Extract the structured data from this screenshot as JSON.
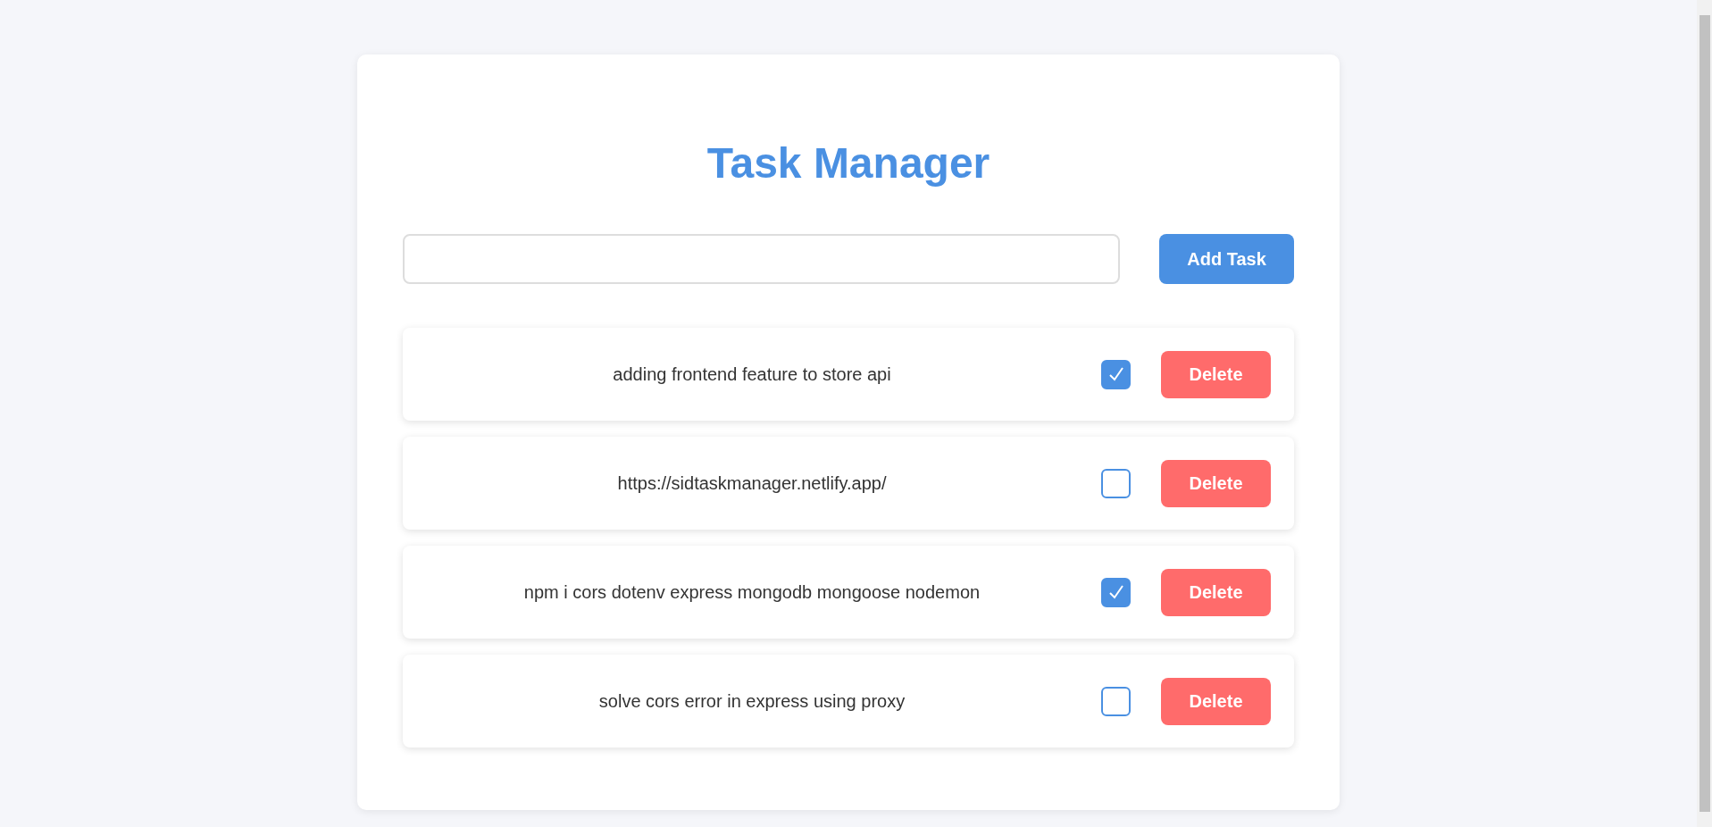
{
  "title": "Task Manager",
  "new_task": {
    "button": "Add Task"
  },
  "tasks": [
    {
      "text": "adding frontend feature to store api",
      "checked": true,
      "delete": "Delete"
    },
    {
      "text": "https://sidtaskmanager.netlify.app/",
      "checked": false,
      "delete": "Delete"
    },
    {
      "text": "npm i cors dotenv express mongodb mongoose nodemon",
      "checked": true,
      "delete": "Delete"
    },
    {
      "text": "solve cors error in express using proxy",
      "checked": false,
      "delete": "Delete"
    }
  ]
}
